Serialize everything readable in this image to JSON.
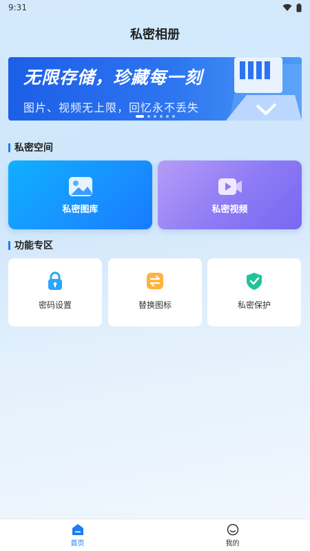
{
  "status": {
    "time": "9:31",
    "wifi_icon": "wifi-icon",
    "battery_icon": "battery-icon"
  },
  "header": {
    "title": "私密相册"
  },
  "banner": {
    "headline": "无限存储，珍藏每一刻",
    "subtitle": "图片、视频无上限，回忆永不丢失",
    "dots": 6,
    "active_dot": 0
  },
  "private_space": {
    "heading": "私密空间",
    "items": [
      {
        "label": "私密图库",
        "icon": "gallery-icon"
      },
      {
        "label": "私密视频",
        "icon": "video-icon"
      }
    ]
  },
  "features": {
    "heading": "功能专区",
    "items": [
      {
        "label": "密码设置",
        "icon": "lock-icon"
      },
      {
        "label": "替换图标",
        "icon": "swap-icon"
      },
      {
        "label": "私密保护",
        "icon": "shield-check-icon"
      }
    ]
  },
  "tabbar": {
    "items": [
      {
        "label": "首页",
        "icon": "home-icon",
        "active": true
      },
      {
        "label": "我的",
        "icon": "profile-icon",
        "active": false
      }
    ]
  },
  "colors": {
    "accent": "#1e7bf3",
    "gallery_card": "#1890ff",
    "video_card": "#8d7af5"
  }
}
